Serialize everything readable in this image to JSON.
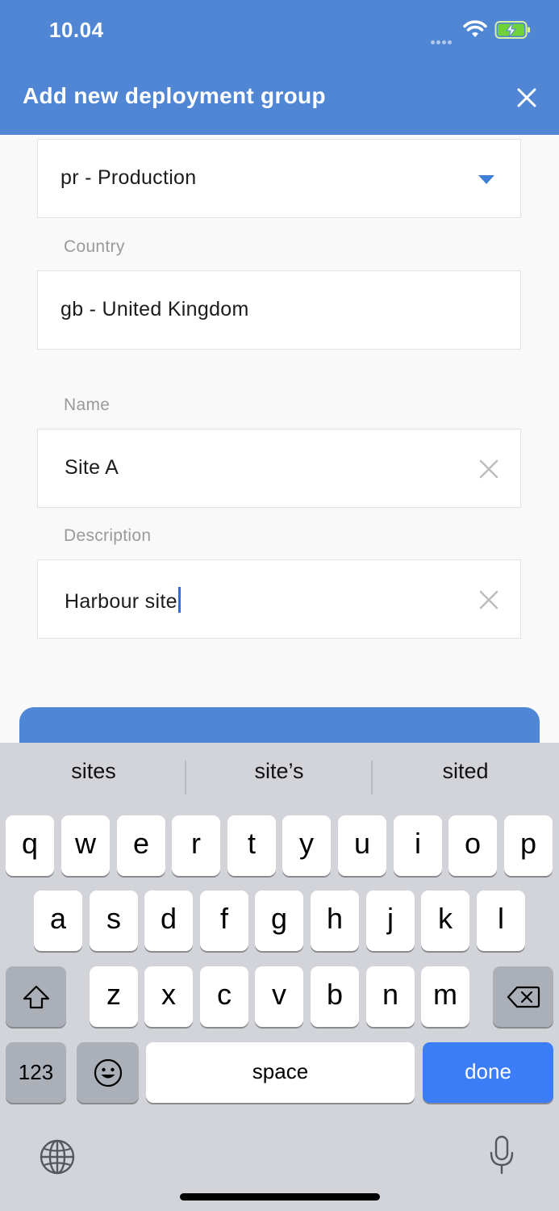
{
  "status_bar": {
    "time": "10.04"
  },
  "header": {
    "title": "Add new deployment group"
  },
  "form": {
    "environment": {
      "value": "pr - Production"
    },
    "country": {
      "label": "Country",
      "value": "gb - United Kingdom"
    },
    "name": {
      "label": "Name",
      "value": "Site A"
    },
    "description": {
      "label": "Description",
      "value": "Harbour site"
    }
  },
  "keyboard": {
    "suggestions": [
      "sites",
      "site’s",
      "sited"
    ],
    "row1": [
      "q",
      "w",
      "e",
      "r",
      "t",
      "y",
      "u",
      "i",
      "o",
      "p"
    ],
    "row2": [
      "a",
      "s",
      "d",
      "f",
      "g",
      "h",
      "j",
      "k",
      "l"
    ],
    "row3": [
      "z",
      "x",
      "c",
      "v",
      "b",
      "n",
      "m"
    ],
    "numbers_label": "123",
    "space_label": "space",
    "done_label": "done"
  },
  "colors": {
    "header": "#5086d3",
    "accent": "#3f7fd8",
    "done_key": "#3a7df6"
  }
}
